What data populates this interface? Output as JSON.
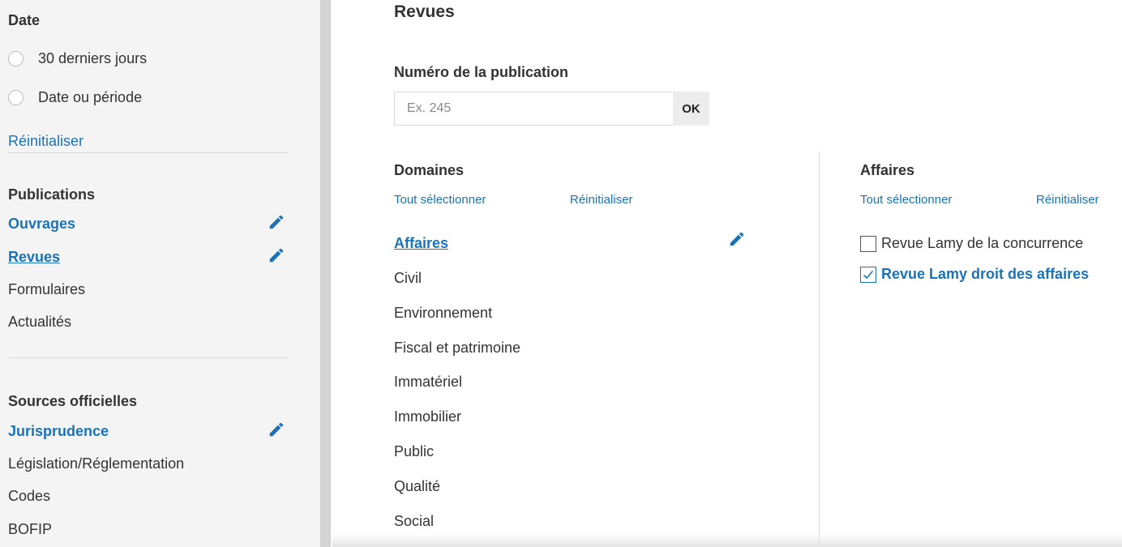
{
  "sidebar": {
    "date": {
      "heading": "Date",
      "options": [
        "30 derniers jours",
        "Date ou période"
      ],
      "reset": "Réinitialiser"
    },
    "publications": {
      "heading": "Publications",
      "items": [
        {
          "label": "Ouvrages",
          "state": "selected"
        },
        {
          "label": "Revues",
          "state": "current"
        },
        {
          "label": "Formulaires",
          "state": "normal"
        },
        {
          "label": "Actualités",
          "state": "normal"
        }
      ]
    },
    "sources": {
      "heading": "Sources officielles",
      "items": [
        {
          "label": "Jurisprudence",
          "state": "selected"
        },
        {
          "label": "Législation/Réglementation",
          "state": "normal"
        },
        {
          "label": "Codes",
          "state": "normal"
        },
        {
          "label": "BOFIP",
          "state": "normal"
        }
      ]
    }
  },
  "main": {
    "title": "Revues",
    "publication_number": {
      "label": "Numéro de la publication",
      "placeholder": "Ex. 245",
      "value": "",
      "button": "OK"
    },
    "domains": {
      "heading": "Domaines",
      "select_all": "Tout sélectionner",
      "reset": "Réinitialiser",
      "items": [
        "Affaires",
        "Civil",
        "Environnement",
        "Fiscal et patrimoine",
        "Immatériel",
        "Immobilier",
        "Public",
        "Qualité",
        "Social"
      ],
      "active_index": 0
    },
    "affaires": {
      "heading": "Affaires",
      "select_all": "Tout sélectionner",
      "reset": "Réinitialiser",
      "items": [
        {
          "label": "Revue Lamy de la concurrence",
          "checked": false
        },
        {
          "label": "Revue Lamy droit des affaires",
          "checked": true
        }
      ]
    }
  },
  "colors": {
    "link": "#1a73b8",
    "text": "#333333",
    "sidebar_bg": "#f4f4f4",
    "divider": "#d9d9d9",
    "button_bg": "#ececec"
  },
  "icons": [
    "radio-icon",
    "pencil-icon",
    "checkbox-icon",
    "checkmark-icon"
  ]
}
